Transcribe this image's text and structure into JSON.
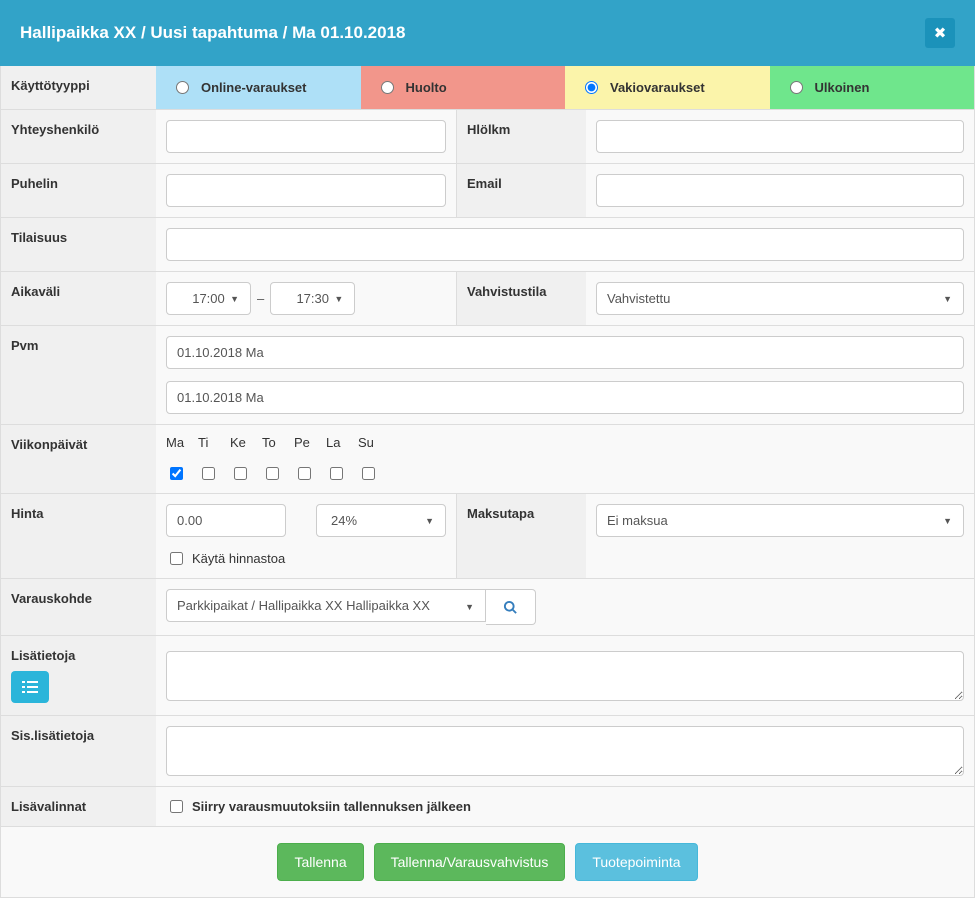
{
  "header": {
    "title": "Hallipaikka XX / Uusi tapahtuma / Ma 01.10.2018"
  },
  "labels": {
    "usage_type": "Käyttötyyppi",
    "contact": "Yhteyshenkilö",
    "persons": "Hlölkm",
    "phone": "Puhelin",
    "email": "Email",
    "event": "Tilaisuus",
    "interval": "Aikaväli",
    "confirm_state": "Vahvistustila",
    "date": "Pvm",
    "weekdays": "Viikonpäivät",
    "price": "Hinta",
    "payment": "Maksutapa",
    "target": "Varauskohde",
    "more_info": "Lisätietoja",
    "internal_info": "Sis.lisätietoja",
    "extra": "Lisävalinnat"
  },
  "usage_types": {
    "online": "Online-varaukset",
    "maintenance": "Huolto",
    "standing": "Vakiovaraukset",
    "external": "Ulkoinen"
  },
  "values": {
    "contact": "",
    "persons": "",
    "phone": "",
    "email": "",
    "event": "",
    "time_from": "17:00",
    "time_to": "17:30",
    "confirm_state": "Vahvistettu",
    "date_from": "01.10.2018 Ma",
    "date_to": "01.10.2018 Ma",
    "price": "0.00",
    "vat": "24%",
    "use_pricelist_label": "Käytä hinnastoa",
    "payment": "Ei maksua",
    "target": "Parkkipaikat / Hallipaikka XX Hallipaikka XX",
    "more_info": "",
    "internal_info": "",
    "extra_goto_label": "Siirry varausmuutoksiin tallennuksen jälkeen"
  },
  "weekdays": {
    "head": [
      "Ma",
      "Ti",
      "Ke",
      "To",
      "Pe",
      "La",
      "Su"
    ],
    "checked": [
      true,
      false,
      false,
      false,
      false,
      false,
      false
    ]
  },
  "buttons": {
    "save": "Tallenna",
    "save_confirm": "Tallenna/Varausvahvistus",
    "product": "Tuotepoiminta"
  }
}
